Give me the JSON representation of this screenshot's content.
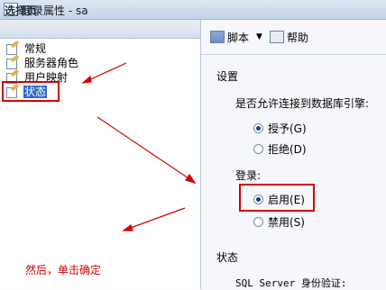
{
  "window": {
    "title": "登录属性 - sa"
  },
  "left_pane": {
    "header": "选择页",
    "pages": [
      {
        "label": "常规",
        "selected": false
      },
      {
        "label": "服务器角色",
        "selected": false
      },
      {
        "label": "用户映射",
        "selected": false
      },
      {
        "label": "状态",
        "selected": true
      }
    ],
    "annotation": "然后，单击确定"
  },
  "toolbar": {
    "script_label": "脚本",
    "help_label": "帮助"
  },
  "settings": {
    "section_title": "设置",
    "connect_question": "是否允许连接到数据库引擎:",
    "grant_label": "授予(G)",
    "deny_label": "拒绝(D)",
    "grant_checked": true,
    "login_label": "登录:",
    "enabled_label": "启用(E)",
    "disabled_label": "禁用(S)",
    "enabled_checked": true
  },
  "status": {
    "section_title": "状态",
    "sql_auth_label": "SQL Server 身份验证:"
  },
  "colors": {
    "annotation_red": "#d40000",
    "selection_blue": "#316ac5"
  }
}
